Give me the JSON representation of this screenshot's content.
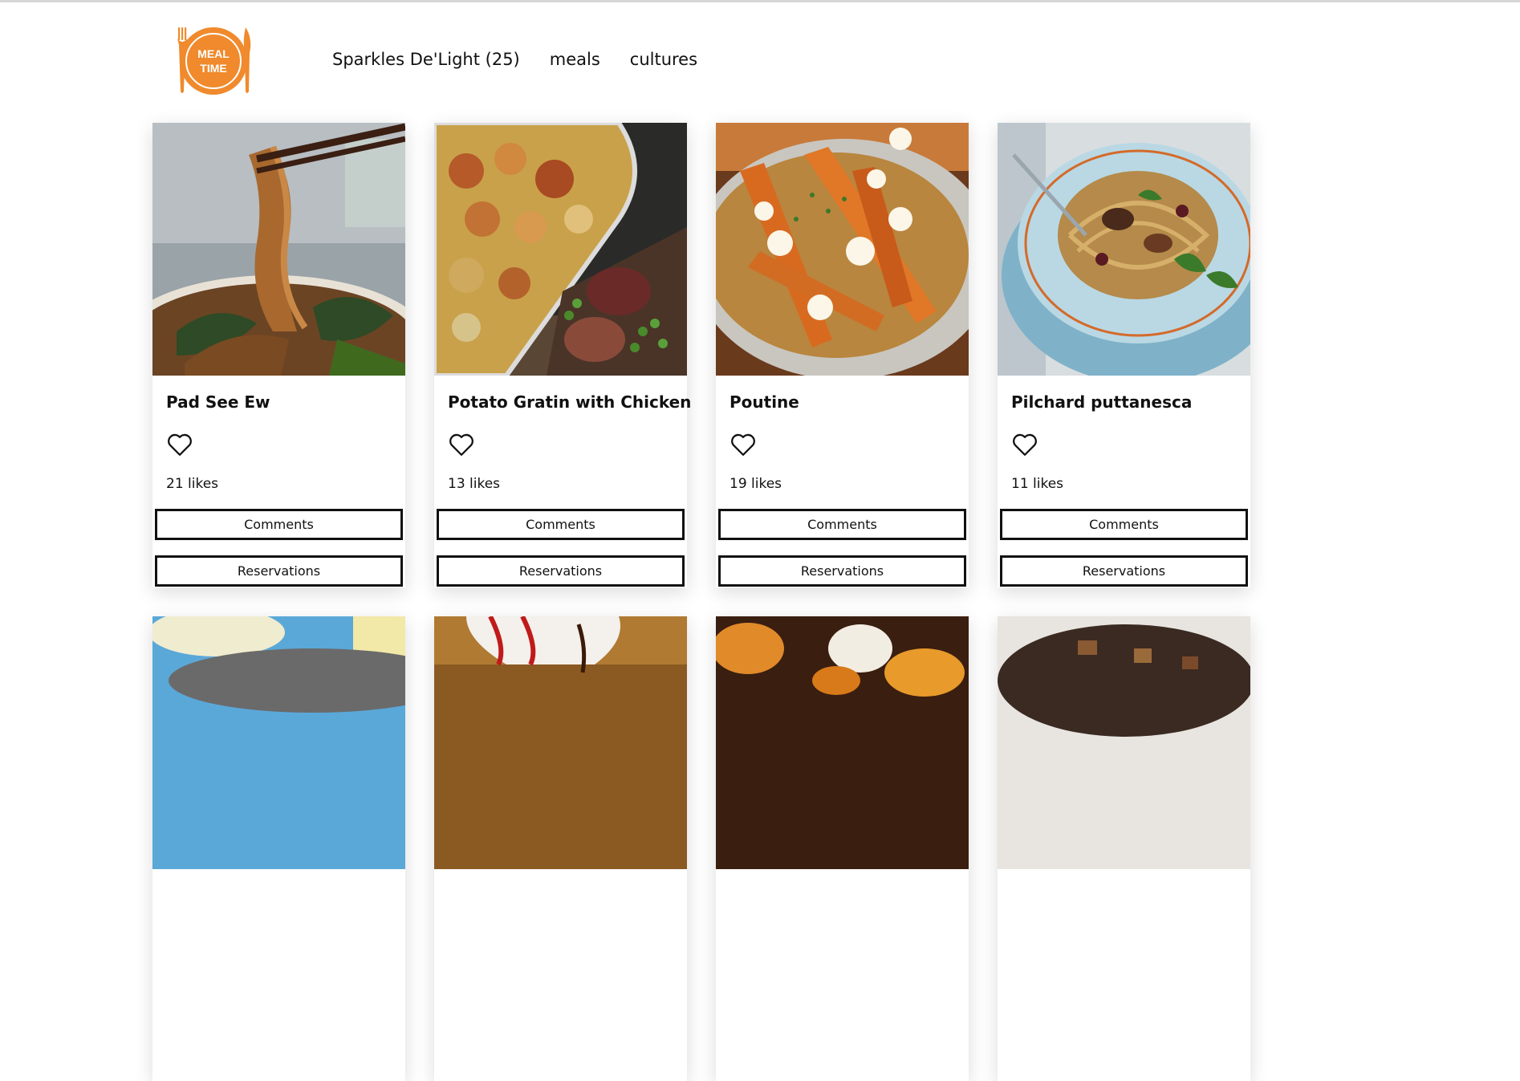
{
  "brand": {
    "logo_text_line1": "MEAL",
    "logo_text_line2": "TIME",
    "accent_color": "#f08a2c"
  },
  "nav": {
    "items": [
      {
        "label": "Sparkles De'Light (25)"
      },
      {
        "label": "meals"
      },
      {
        "label": "cultures"
      }
    ]
  },
  "meals": [
    {
      "title": "Pad See Ew",
      "likes": "21 likes",
      "comments_label": "Comments",
      "reservations_label": "Reservations",
      "image": "noodles-photo"
    },
    {
      "title": "Potato Gratin with Chicken",
      "likes": "13 likes",
      "comments_label": "Comments",
      "reservations_label": "Reservations",
      "image": "gratin-photo"
    },
    {
      "title": "Poutine",
      "likes": "19 likes",
      "comments_label": "Comments",
      "reservations_label": "Reservations",
      "image": "poutine-photo"
    },
    {
      "title": "Pilchard puttanesca",
      "likes": "11 likes",
      "comments_label": "Comments",
      "reservations_label": "Reservations",
      "image": "pasta-photo"
    }
  ],
  "meals_row2_images": [
    "mash-photo",
    "pitcher-photo",
    "pumpkins-photo",
    "dessert-photo"
  ],
  "icons": {
    "like": "heart-outline-icon"
  }
}
